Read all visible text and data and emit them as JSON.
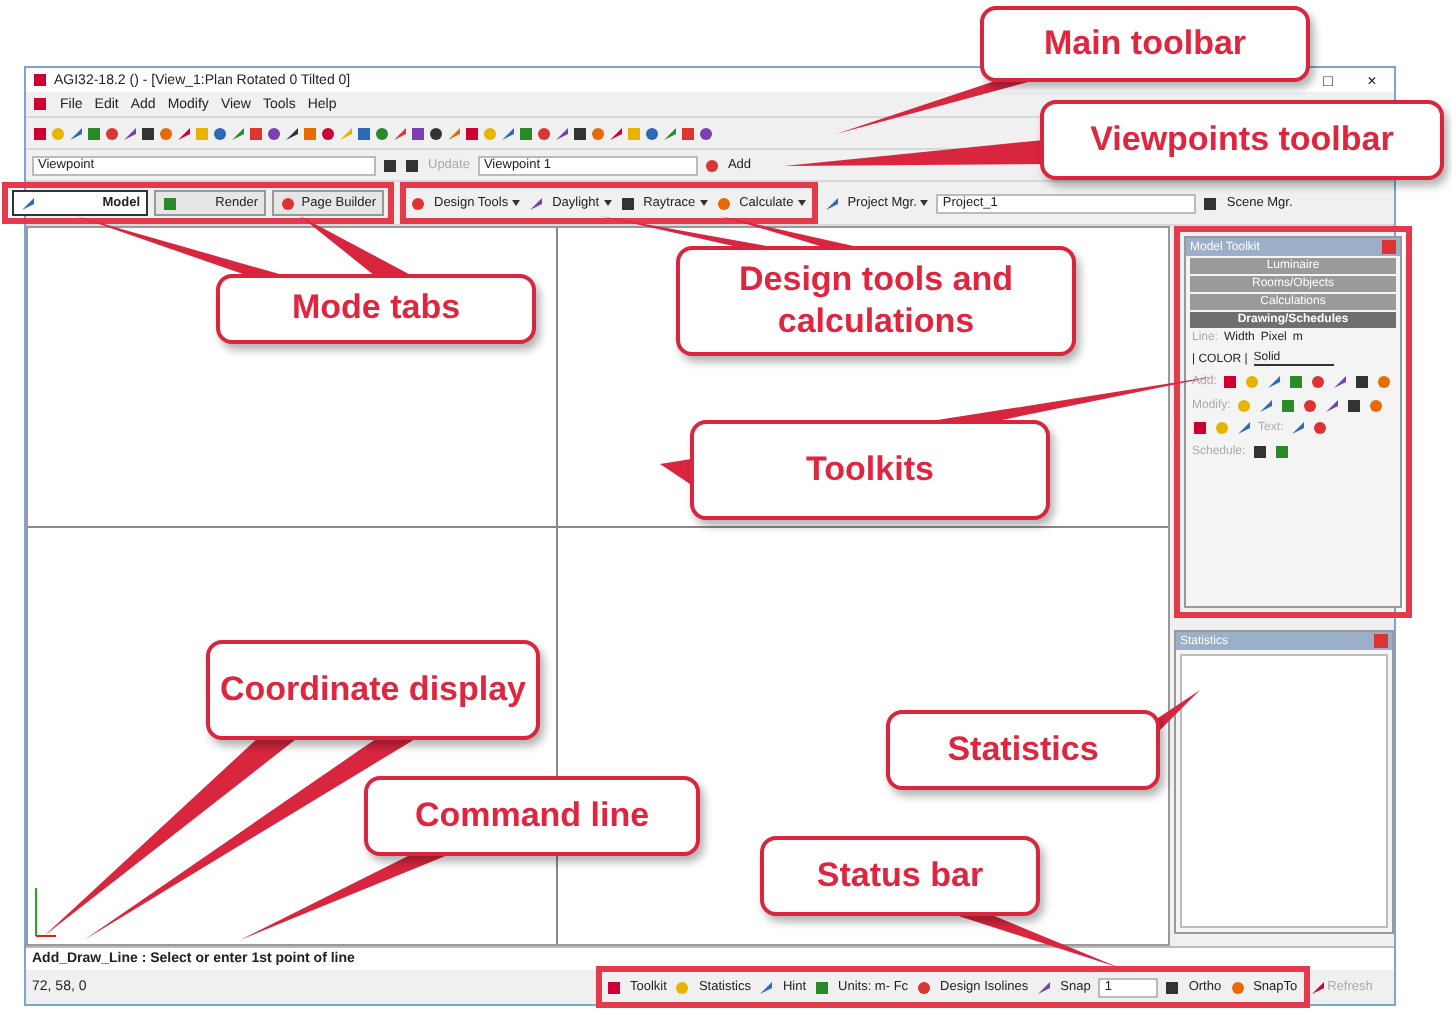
{
  "window": {
    "title": "AGI32-18.2 () - [View_1:Plan Rotated 0 Tilted 0]",
    "controls": [
      "□",
      "×"
    ]
  },
  "menu": [
    "File",
    "Edit",
    "Add",
    "Modify",
    "View",
    "Tools",
    "Help"
  ],
  "viewpoint_bar": {
    "viewpoint": "Viewpoint",
    "update": {
      "label": "Update",
      "disabled": true
    },
    "viewpoint_name": "Viewpoint 1",
    "add": "Add"
  },
  "mode_tabs": [
    {
      "label": "Model",
      "selected": true
    },
    {
      "label": "Render",
      "selected": false
    },
    {
      "label": "Page Builder",
      "selected": false
    }
  ],
  "design_toolbar": [
    {
      "label": "Design Tools"
    },
    {
      "label": "Daylight"
    },
    {
      "label": "Raytrace"
    },
    {
      "label": "Calculate"
    },
    {
      "label": "Project Mgr."
    }
  ],
  "project": "Project_1",
  "scene": "Scene Mgr.",
  "toolkit": {
    "title": "Model Toolkit",
    "sections": [
      {
        "label": "Luminaire",
        "selected": false
      },
      {
        "label": "Rooms/Objects",
        "selected": false
      },
      {
        "label": "Calculations",
        "selected": false
      },
      {
        "label": "Drawing/Schedules",
        "selected": true
      }
    ],
    "line_label": "Line:",
    "width_label": "Width",
    "width_value": "Pixel",
    "unit": "m",
    "color_button": "| COLOR |",
    "style": "Solid",
    "add_label": "Add:",
    "modify_label": "Modify:",
    "text_label": "Text:",
    "schedule_label": "Schedule:"
  },
  "statistics": {
    "title": "Statistics"
  },
  "command_line": "Add_Draw_Line : Select or enter 1st point of line",
  "coordinates": "72, 58, 0",
  "status_bar": [
    {
      "label": "Toolkit",
      "disabled": false
    },
    {
      "label": "Statistics",
      "disabled": false
    },
    {
      "label": "Hint",
      "disabled": false
    },
    {
      "label": "Units: m- Fc",
      "disabled": false
    },
    {
      "label": "Design Isolines",
      "disabled": false
    },
    {
      "label": "Snap",
      "disabled": false
    },
    {
      "label": "Ortho",
      "disabled": false
    },
    {
      "label": "SnapTo",
      "disabled": false
    },
    {
      "label": "Refresh",
      "disabled": true
    }
  ],
  "snap_value": "1",
  "callouts": [
    "Main toolbar",
    "Viewpoints toolbar",
    "Mode tabs",
    "Design tools and calculations",
    "Toolkits",
    "Coordinate display",
    "Statistics",
    "Command line",
    "Status bar"
  ]
}
